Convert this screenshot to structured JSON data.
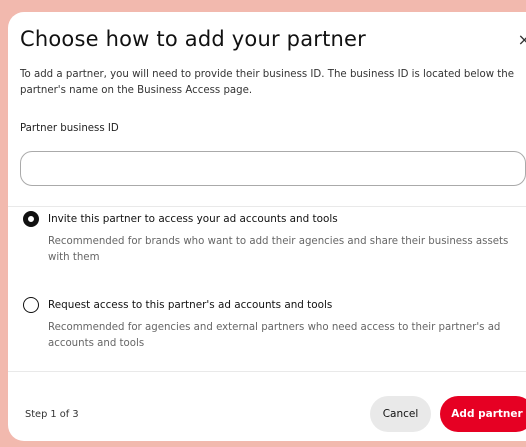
{
  "dialog": {
    "title": "Choose how to add your partner",
    "close_symbol": "×",
    "description": "To add a partner, you will need to provide their business ID. The business ID is located below the partner's name on the Business Access page.",
    "field_label": "Partner business ID",
    "field_value": "",
    "field_placeholder": ""
  },
  "options": [
    {
      "label": "Invite this partner to access your ad accounts and tools",
      "description": "Recommended for brands who want to add their agencies and share their business assets with them",
      "selected": true
    },
    {
      "label": "Request access to this partner's ad accounts and tools",
      "description": "Recommended for agencies and external partners who need access to their partner's ad accounts and tools",
      "selected": false
    }
  ],
  "footer": {
    "step": "Step 1 of 3",
    "cancel_label": "Cancel",
    "add_label": "Add partner"
  },
  "colors": {
    "backdrop": "#f2b9ae",
    "primary": "#e60023",
    "secondary_button": "#e9e9e9"
  },
  "icons": {
    "close": "close-icon"
  }
}
